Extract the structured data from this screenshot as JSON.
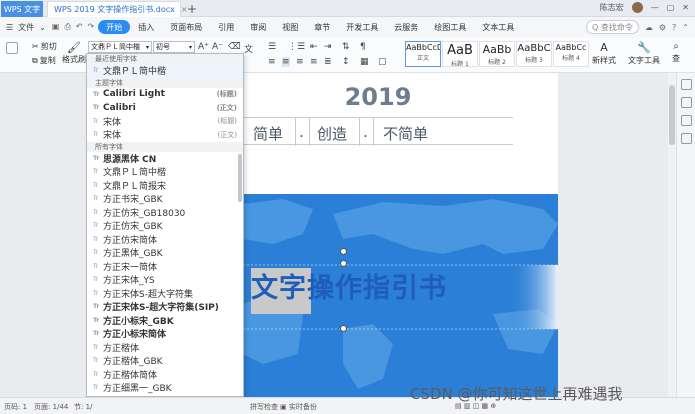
{
  "titlebar": {
    "app_tab": "WPS 文字",
    "doc_tab": "WPS 2019 文字操作指引书.docx",
    "user": "陈志宏"
  },
  "menubar": {
    "file_label": "文件",
    "items": [
      "开始",
      "插入",
      "页面布局",
      "引用",
      "审阅",
      "视图",
      "章节",
      "开发工具",
      "云服务",
      "绘图工具",
      "文本工具"
    ],
    "search_placeholder": "Q 查找命令"
  },
  "ribbon": {
    "cut": "剪切",
    "copy": "复制",
    "format_painter": "格式刷",
    "font_name": "文鼎ＰＬ简中楷",
    "font_size": "初号",
    "styles": [
      {
        "sample": "AaBbCcD",
        "caption": "正文",
        "big": false
      },
      {
        "sample": "AaB",
        "caption": "标题 1",
        "big": true
      },
      {
        "sample": "AaBb",
        "caption": "标题 2",
        "big": true
      },
      {
        "sample": "AaBbC",
        "caption": "标题 3",
        "big": false
      },
      {
        "sample": "AaBbCc",
        "caption": "标题 4",
        "big": false
      }
    ],
    "new_style": "新样式",
    "text_tools": "文字工具",
    "find": "查"
  },
  "font_dropdown": {
    "recent_header": "最近使用字体",
    "recent": [
      "文鼎ＰＬ简中楷"
    ],
    "theme_header": "主题字体",
    "theme": [
      {
        "name": "Calibri Light",
        "tag": "(标题)"
      },
      {
        "name": "Calibri",
        "tag": "(正文)"
      },
      {
        "name": "宋体",
        "tag": "(标题)"
      },
      {
        "name": "宋体",
        "tag": "(正文)"
      }
    ],
    "all_header": "所有字体",
    "all": [
      {
        "name": "思源黑体 CN",
        "bold": true
      },
      {
        "name": "文鼎ＰＬ简中楷",
        "bold": false
      },
      {
        "name": "文鼎ＰＬ简报宋",
        "bold": false
      },
      {
        "name": "方正书宋_GBK",
        "bold": false
      },
      {
        "name": "方正仿宋_GB18030",
        "bold": false
      },
      {
        "name": "方正仿宋_GBK",
        "bold": false
      },
      {
        "name": "方正仿宋简体",
        "bold": false
      },
      {
        "name": "方正黑体_GBK",
        "bold": false
      },
      {
        "name": "方正宋一简体",
        "bold": false
      },
      {
        "name": "方正宋体_YS",
        "bold": false
      },
      {
        "name": "方正宋体S-超大字符集",
        "bold": false
      },
      {
        "name": "方正宋体S-超大字符集(SIP)",
        "bold": true
      },
      {
        "name": "方正小标宋_GBK",
        "bold": true
      },
      {
        "name": "方正小标宋简体",
        "bold": true
      },
      {
        "name": "方正楷体",
        "bold": false
      },
      {
        "name": "方正楷体_GBK",
        "bold": false
      },
      {
        "name": "方正楷体简体",
        "bold": false
      },
      {
        "name": "方正细黑一_GBK",
        "bold": false
      }
    ]
  },
  "document": {
    "year": "2019",
    "subtitle": [
      "简单",
      ".",
      "创造",
      ".",
      "不简单"
    ],
    "banner_title": "文字操作指引书"
  },
  "statusbar": {
    "page": "页码: 1",
    "pages": "页面: 1/44",
    "section": "节: 1/",
    "spell": "拼写检查",
    "backup": "实时备份"
  },
  "watermark": "CSDN @你可知这世上再难遇我",
  "colors": {
    "accent": "#2b8cf4",
    "banner_blue": "#2b7fd6",
    "title_blue": "#1f5eb8",
    "year_gray": "#6d7d8f"
  }
}
